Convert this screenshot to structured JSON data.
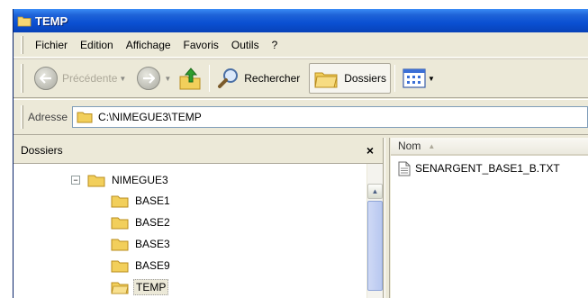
{
  "window": {
    "title": "TEMP"
  },
  "menu": {
    "items": [
      {
        "label": "Fichier"
      },
      {
        "label": "Edition"
      },
      {
        "label": "Affichage"
      },
      {
        "label": "Favoris"
      },
      {
        "label": "Outils"
      },
      {
        "label": "?"
      }
    ]
  },
  "toolbar": {
    "back_label": "Précédente",
    "search_label": "Rechercher",
    "folders_label": "Dossiers"
  },
  "address": {
    "label": "Adresse",
    "value": "C:\\NIMEGUE3\\TEMP"
  },
  "folders_pane": {
    "title": "Dossiers",
    "close": "×",
    "tree": [
      {
        "label": "NIMEGUE3",
        "expander": "−"
      },
      {
        "label": "BASE1"
      },
      {
        "label": "BASE2"
      },
      {
        "label": "BASE3"
      },
      {
        "label": "BASE9"
      },
      {
        "label": "TEMP",
        "selected": true
      }
    ]
  },
  "list_pane": {
    "column_name": "Nom",
    "files": [
      {
        "name": "SENARGENT_BASE1_B.TXT",
        "icon": "text-file-icon"
      }
    ]
  },
  "icons": {
    "folder": "folder-icon",
    "back": "back-arrow-icon",
    "forward": "forward-arrow-icon",
    "up": "up-folder-icon",
    "search": "magnifier-icon",
    "views": "views-icon"
  },
  "colors": {
    "titlebar": "#0a50d2",
    "window_face": "#ece9d8",
    "folder_yellow": "#f2cf5b"
  }
}
